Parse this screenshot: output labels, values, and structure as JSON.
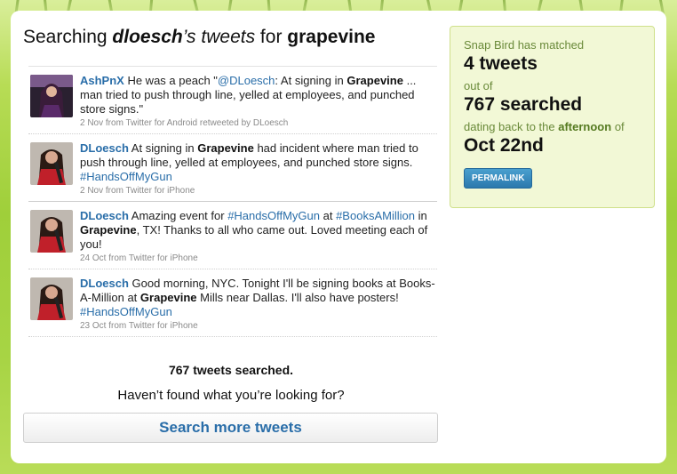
{
  "header": {
    "prefix": "Searching ",
    "user": "dloesch",
    "possessive": "’s tweets",
    "for_text": " for ",
    "query": "grapevine"
  },
  "tweets": [
    {
      "user": "AshPnX",
      "parts": [
        " He was a peach \"",
        "@DLoesch",
        ": At signing in ",
        "Grapevine",
        " ... man tried to push through line, yelled at employees, and punched store signs.\""
      ],
      "meta": "2 Nov from Twitter for Android retweeted by DLoesch"
    },
    {
      "user": "DLoesch",
      "parts": [
        " At signing in ",
        "Grapevine",
        " had incident where man tried to push through line, yelled at employees, and punched store signs. ",
        "#HandsOffMyGun"
      ],
      "meta": "2 Nov from Twitter for iPhone"
    },
    {
      "user": "DLoesch",
      "parts": [
        " Amazing event for ",
        "#HandsOffMyGun",
        " at ",
        "#BooksAMillion",
        " in ",
        "Grapevine",
        ", TX! Thanks to all who came out. Loved meeting each of you!"
      ],
      "meta": "24 Oct from Twitter for iPhone"
    },
    {
      "user": "DLoesch",
      "parts": [
        " Good morning, NYC. Tonight I'll be signing books at Books-A-Million at ",
        "Grapevine",
        " Mills near Dallas. I'll also have posters! ",
        "#HandsOffMyGun"
      ],
      "meta": "23 Oct from Twitter for iPhone"
    }
  ],
  "summary": {
    "searched": "767 tweets searched.",
    "prompt": "Haven’t found what you’re looking for?",
    "more_button": "Search more tweets"
  },
  "panel": {
    "matched_label": "Snap Bird has matched",
    "matched_value": "4 tweets",
    "outof_label": "out of",
    "searched_value": "767 searched",
    "dating_prefix": "dating back to the ",
    "dating_part": "afternoon",
    "dating_suffix": " of",
    "date_value": "Oct 22nd",
    "permalink": "PERMALINK"
  },
  "colors": {
    "link": "#2a6ea9",
    "panel_bg": "#f2f8d6",
    "panel_label": "#6a8a3a",
    "button_blue": "#2b78ad"
  }
}
